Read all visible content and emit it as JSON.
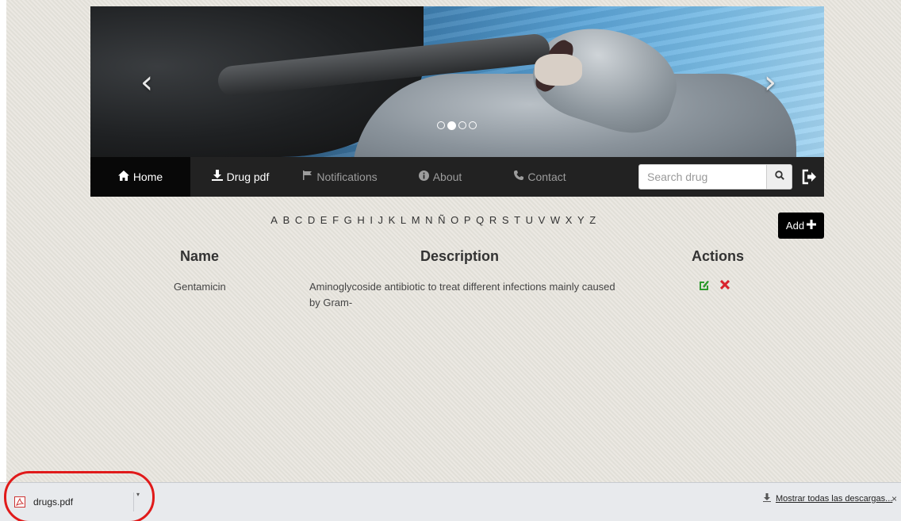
{
  "carousel": {
    "prev_glyph": "‹",
    "next_glyph": "›",
    "slides_count": 4,
    "active_slide": 2
  },
  "navbar": {
    "items": [
      {
        "label": "Home",
        "icon": "home-icon"
      },
      {
        "label": "Drug pdf",
        "icon": "download-icon"
      },
      {
        "label": "Notifications",
        "icon": "flag-icon"
      },
      {
        "label": "About",
        "icon": "info-icon"
      },
      {
        "label": "Contact",
        "icon": "phone-icon"
      }
    ],
    "search_placeholder": "Search drug",
    "search_icon": "search-icon",
    "logout_icon": "logout-icon"
  },
  "alphabet": [
    "A",
    "B",
    "C",
    "D",
    "E",
    "F",
    "G",
    "H",
    "I",
    "J",
    "K",
    "L",
    "M",
    "N",
    "Ñ",
    "O",
    "P",
    "Q",
    "R",
    "S",
    "T",
    "U",
    "V",
    "W",
    "X",
    "Y",
    "Z"
  ],
  "add_button": {
    "label": "Add",
    "icon": "plus-icon"
  },
  "table": {
    "headers": {
      "name": "Name",
      "description": "Description",
      "actions": "Actions"
    },
    "rows": [
      {
        "name": "Gentamicin",
        "description_line1": "Aminoglycoside antibiotic to treat different infections mainly caused",
        "description_line2": "by Gram-"
      }
    ]
  },
  "download_bar": {
    "file_name": "drugs.pdf",
    "show_all_label": "Mostrar todas las descargas...",
    "close_glyph": "×"
  },
  "colors": {
    "navbar_bg": "#222222",
    "delete_red": "#d9232d",
    "edit_green": "#2e9a2e",
    "highlight_red": "#e01a1a"
  }
}
